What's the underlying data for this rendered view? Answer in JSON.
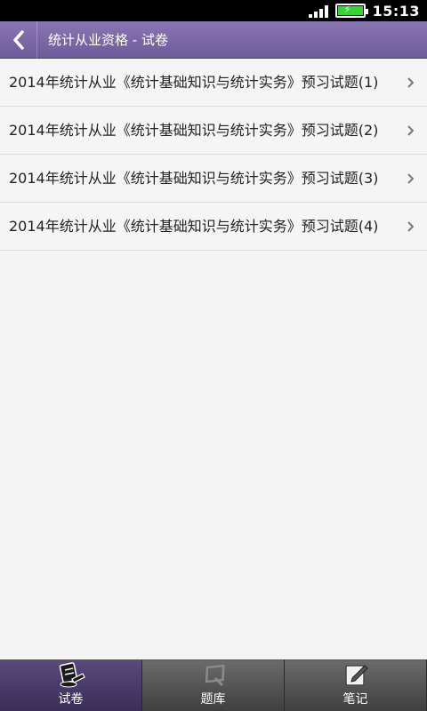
{
  "status_bar": {
    "time": "15:13"
  },
  "header": {
    "title": "统计从业资格 - 试卷"
  },
  "list": {
    "items": [
      {
        "label": "2014年统计从业《统计基础知识与统计实务》预习试题(1)"
      },
      {
        "label": "2014年统计从业《统计基础知识与统计实务》预习试题(2)"
      },
      {
        "label": "2014年统计从业《统计基础知识与统计实务》预习试题(3)"
      },
      {
        "label": "2014年统计从业《统计基础知识与统计实务》预习试题(4)"
      }
    ]
  },
  "tab_bar": {
    "tabs": [
      {
        "label": "试卷",
        "icon": "exam-paper-icon",
        "active": true
      },
      {
        "label": "题库",
        "icon": "question-bank-icon",
        "active": false
      },
      {
        "label": "笔记",
        "icon": "note-icon",
        "active": false
      }
    ]
  },
  "colors": {
    "header": "#7a66a6",
    "active_tab": "#4a3b6b",
    "battery": "#37d337"
  }
}
